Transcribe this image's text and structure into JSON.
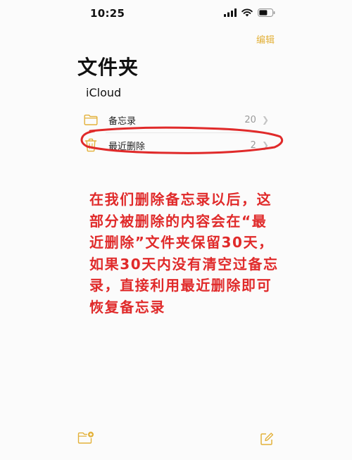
{
  "status_bar": {
    "time": "10:25"
  },
  "nav": {
    "edit_label": "编辑"
  },
  "page": {
    "title": "文件夹",
    "section": "iCloud"
  },
  "folders": [
    {
      "name": "备忘录",
      "count": "20",
      "icon": "folder-icon"
    },
    {
      "name": "最近删除",
      "count": "2",
      "icon": "trash-icon"
    }
  ],
  "annotation": {
    "text": "在我们删除备忘录以后，这部分被删除的内容会在“最近删除”文件夹保留30天，如果30天内没有清空过备忘录，直接利用最近删除即可恢复备忘录",
    "color": "#e02a2a"
  },
  "colors": {
    "accent": "#e3b13a"
  },
  "toolbar": {
    "left_icon": "new-folder-icon",
    "right_icon": "compose-icon"
  }
}
